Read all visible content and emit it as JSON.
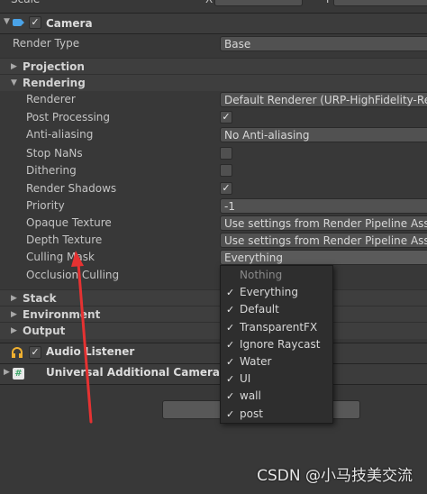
{
  "top_partial": {
    "label": "Scale",
    "x_label": "X",
    "y_label": "Y"
  },
  "camera": {
    "title": "Camera",
    "render_type": {
      "label": "Render Type",
      "value": "Base"
    },
    "projection": "Projection",
    "rendering": {
      "title": "Rendering",
      "renderer": {
        "label": "Renderer",
        "value": "Default Renderer (URP-HighFidelity-Renc"
      },
      "post_processing": {
        "label": "Post Processing",
        "checked": true
      },
      "anti_aliasing": {
        "label": "Anti-aliasing",
        "value": "No Anti-aliasing"
      },
      "stop_nans": {
        "label": "Stop NaNs",
        "checked": false
      },
      "dithering": {
        "label": "Dithering",
        "checked": false
      },
      "render_shadows": {
        "label": "Render Shadows",
        "checked": true
      },
      "priority": {
        "label": "Priority",
        "value": "-1"
      },
      "opaque_texture": {
        "label": "Opaque Texture",
        "value": "Use settings from Render Pipeline Asset"
      },
      "depth_texture": {
        "label": "Depth Texture",
        "value": "Use settings from Render Pipeline Asset"
      },
      "culling_mask": {
        "label": "Culling Mask",
        "value": "Everything"
      },
      "occlusion_culling": {
        "label": "Occlusion Culling"
      }
    },
    "stack": "Stack",
    "environment": "Environment",
    "output": "Output"
  },
  "audio_listener": {
    "title": "Audio Listener"
  },
  "urp_camera_data": {
    "title": "Universal Additional Camera Data"
  },
  "culling_dropdown": {
    "options": [
      {
        "label": "Nothing",
        "checked": false
      },
      {
        "label": "Everything",
        "checked": true
      },
      {
        "label": "Default",
        "checked": true
      },
      {
        "label": "TransparentFX",
        "checked": true
      },
      {
        "label": "Ignore Raycast",
        "checked": true
      },
      {
        "label": "Water",
        "checked": true
      },
      {
        "label": "UI",
        "checked": true
      },
      {
        "label": "wall",
        "checked": true
      },
      {
        "label": "post",
        "checked": true
      }
    ],
    "check_glyph": "✓"
  },
  "watermark": "CSDN @小马技美交流",
  "colors": {
    "accent_arrow": "#e53232",
    "camera_icon": "#4aa3e8",
    "audio_icon": "#f0b030",
    "script_icon": "#3fa86b"
  }
}
